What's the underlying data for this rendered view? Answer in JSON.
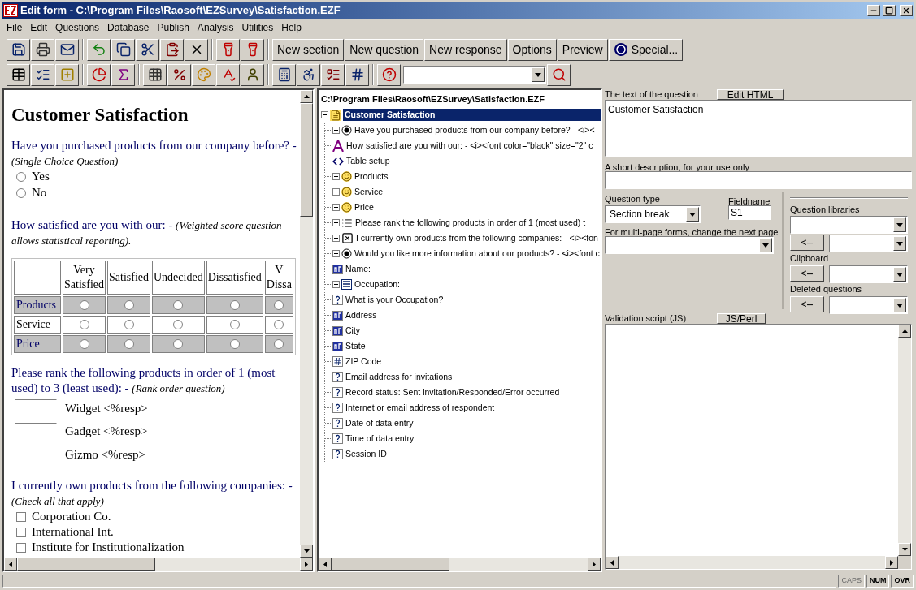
{
  "window": {
    "title": "Edit form - C:\\Program Files\\Raosoft\\EZSurvey\\Satisfaction.EZF"
  },
  "menu": [
    "File",
    "Edit",
    "Questions",
    "Database",
    "Publish",
    "Analysis",
    "Utilities",
    "Help"
  ],
  "toolbar": {
    "buttons": [
      {
        "label": "New section",
        "kind": "text"
      },
      {
        "label": "New question",
        "kind": "text"
      },
      {
        "label": "New response",
        "kind": "text"
      },
      {
        "label": "Options",
        "kind": "text"
      },
      {
        "label": "Preview",
        "kind": "text"
      },
      {
        "label": "Special...",
        "kind": "with-icon"
      }
    ]
  },
  "form": {
    "title": "Customer Satisfaction",
    "questions": [
      {
        "kind": "single",
        "text": "Have you purchased products from our company before? -",
        "note": "(Single Choice Question)",
        "options": [
          {
            "label": "Yes",
            "selected": false
          },
          {
            "label": "No",
            "selected": false
          }
        ]
      },
      {
        "kind": "matrix",
        "text": "How satisfied are you with our: -",
        "note": "(Weighted score question allows statistical reporting).",
        "columns": [
          [
            "Very",
            "Satisfied"
          ],
          [
            "Satisfied"
          ],
          [
            "Undecided"
          ],
          [
            "Dissatisfied"
          ],
          [
            "V",
            "Dissa"
          ]
        ],
        "rows": [
          {
            "label": "Products",
            "shaded": true,
            "answers": [
              false,
              false,
              false,
              false,
              false
            ]
          },
          {
            "label": "Service",
            "shaded": false,
            "answers": [
              false,
              false,
              false,
              false,
              false
            ]
          },
          {
            "label": "Price",
            "shaded": true,
            "answers": [
              false,
              false,
              false,
              false,
              false
            ]
          }
        ]
      },
      {
        "kind": "rank",
        "text": "Please rank the following products in order of 1 (most used) to 3 (least used): -",
        "note": "(Rank order question)",
        "options": [
          {
            "label": "Widget <%resp>"
          },
          {
            "label": "Gadget <%resp>"
          },
          {
            "label": "Gizmo <%resp>"
          }
        ]
      },
      {
        "kind": "multi",
        "text": "I currently own products from the following companies: -",
        "note": "(Check all that apply)",
        "options": [
          {
            "label": "Corporation Co.",
            "checked": false
          },
          {
            "label": "International Int.",
            "checked": false
          },
          {
            "label": "Institute for Institutionalization",
            "checked": false
          }
        ]
      }
    ]
  },
  "tree": {
    "path": "C:\\Program Files\\Raosoft\\EZSurvey\\Satisfaction.EZF",
    "root": {
      "label": "Customer Satisfaction",
      "selected": true,
      "expanded": true,
      "children": [
        {
          "label": "Have you purchased products from our company before? - <i><",
          "kind": "radio",
          "expandable": true
        },
        {
          "label": "How satisfied are you with our: - <i><font color=\"black\" size=\"2\" c",
          "kind": "style",
          "expandable": false
        },
        {
          "label": "Table setup",
          "kind": "code",
          "expandable": false
        },
        {
          "label": "Products",
          "kind": "smiley",
          "expandable": true
        },
        {
          "label": "Service",
          "kind": "smiley",
          "expandable": true
        },
        {
          "label": "Price",
          "kind": "smiley",
          "expandable": true
        },
        {
          "label": "Please rank the following products in order of 1 (most used) t",
          "kind": "list",
          "expandable": true
        },
        {
          "label": "I currently own products from the following companies: - <i><fon",
          "kind": "checkbox",
          "expandable": true
        },
        {
          "label": "Would you like more information about our products? - <i><font c",
          "kind": "radio",
          "expandable": true
        },
        {
          "label": "Name:",
          "kind": "text-field",
          "expandable": false
        },
        {
          "label": "Occupation:",
          "kind": "dropdown",
          "expandable": true
        },
        {
          "label": "What is your Occupation?",
          "kind": "question",
          "expandable": false
        },
        {
          "label": "Address",
          "kind": "text-field",
          "expandable": false
        },
        {
          "label": "City",
          "kind": "text-field",
          "expandable": false
        },
        {
          "label": "State",
          "kind": "text-field",
          "expandable": false
        },
        {
          "label": "ZIP Code",
          "kind": "number",
          "expandable": false
        },
        {
          "label": "Email address for invitations",
          "kind": "question",
          "expandable": false
        },
        {
          "label": "Record status: Sent invitation/Responded/Error occurred",
          "kind": "question",
          "expandable": false
        },
        {
          "label": "Internet or email address of respondent",
          "kind": "question",
          "expandable": false
        },
        {
          "label": "Date of data entry",
          "kind": "question",
          "expandable": false
        },
        {
          "label": "Time of data entry",
          "kind": "question",
          "expandable": false
        },
        {
          "label": "Session ID",
          "kind": "question",
          "expandable": false
        }
      ]
    }
  },
  "editor": {
    "question_text_label": "The text of the question",
    "edit_html_button": "Edit HTML",
    "question_text": "Customer Satisfaction",
    "short_description_label": "A short description, for your use only",
    "question_type_label": "Question type",
    "question_type": "Section break",
    "fieldname_label": "Fieldname",
    "fieldname": "S1",
    "next_page_label": "For multi-page forms, change the next page",
    "side_sections": [
      {
        "kind": "library",
        "label": "Question libraries",
        "button": "<--"
      },
      {
        "kind": "simple",
        "label": "Clipboard",
        "button": "<--"
      },
      {
        "kind": "simple",
        "label": "Deleted questions",
        "button": "<--"
      }
    ],
    "validation_label": "Validation script (JS)",
    "js_perl_button": "JS/Perl"
  },
  "status_bar": {
    "indicators": [
      {
        "label": "CAPS",
        "active": false
      },
      {
        "label": "NUM",
        "active": true
      },
      {
        "label": "OVR",
        "active": true
      }
    ]
  }
}
